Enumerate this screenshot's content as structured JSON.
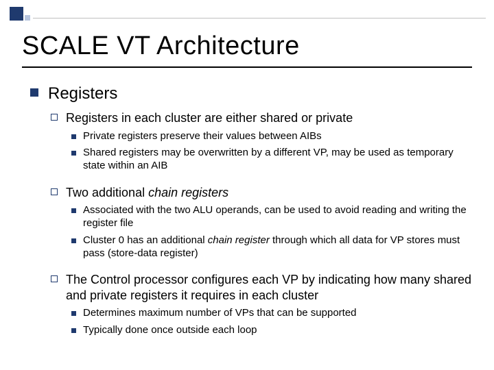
{
  "title": "SCALE VT Architecture",
  "l1": "Registers",
  "l2a": "Registers in each cluster are either shared or private",
  "l3a1": "Private registers preserve their values between AIBs",
  "l3a2": "Shared registers may be overwritten by a different VP, may be used as temporary state within an AIB",
  "l2b_pre": "Two additional ",
  "l2b_it": "chain registers",
  "l3b1": "Associated with the two ALU operands, can be used to avoid reading and writing the register file",
  "l3b2_pre": "Cluster 0 has an additional ",
  "l3b2_it": "chain register ",
  "l3b2_post": "through which all data for VP stores must pass (store-data register)",
  "l2c": "The Control processor configures each VP by indicating how many shared and private registers it requires in each cluster",
  "l3c1": "Determines maximum number of VPs that can be supported",
  "l3c2": "Typically done once outside each loop"
}
